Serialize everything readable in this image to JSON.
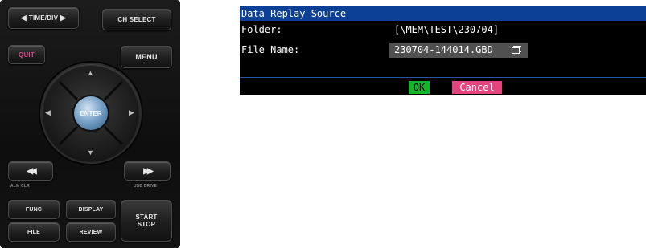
{
  "panel": {
    "time_div": "TIME/DIV",
    "ch_select": "CH SELECT",
    "quit": "QUIT",
    "menu": "MENU",
    "enter": "ENTER",
    "alm_clr": "ALM CLR",
    "usb_drive": "USB DRIVE",
    "func": "FUNC",
    "display": "DISPLAY",
    "file": "FILE",
    "review": "REVIEW",
    "start": "START",
    "stop": "STOP"
  },
  "dialog": {
    "title": "Data Replay Source",
    "folder_label": "Folder:",
    "folder_value": "[\\MEM\\TEST\\230704]",
    "filename_label": "File Name:",
    "filename_value": "230704-144014.GBD",
    "ok_label": "OK",
    "cancel_label": "Cancel",
    "colors": {
      "title_bar": "#0c3f96",
      "ok": "#14b528",
      "cancel": "#e4437e",
      "field": "#505050"
    }
  }
}
